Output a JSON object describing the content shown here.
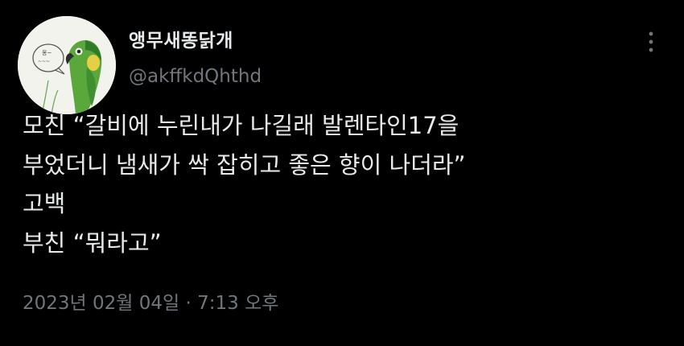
{
  "author": {
    "display_name": "앵무새똥닭개",
    "handle": "@akffkdQhthd",
    "avatar_icon": "parrot-avatar-icon"
  },
  "menu": {
    "icon": "more-vertical-icon"
  },
  "tweet": {
    "lines": [
      "모친 “갈비에 누린내가 나길래 발렌타인17을",
      "부었더니 냄새가 싹 잡히고 좋은 향이 나더라”",
      "고백",
      "부친 “뭐라고”"
    ]
  },
  "meta": {
    "date": "2023년 02월 04일",
    "separator": "·",
    "time": "7:13 오후"
  },
  "colors": {
    "background": "#000000",
    "text_primary": "#e7e9ea",
    "text_secondary": "#71767b"
  }
}
